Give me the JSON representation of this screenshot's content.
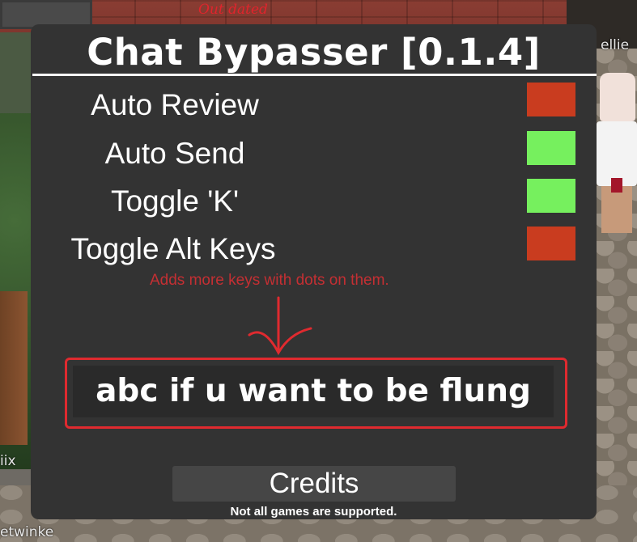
{
  "overlay": {
    "outdated_note": "Out dated"
  },
  "background": {
    "name_tags": [
      "ellie",
      "iix",
      "etwinke"
    ]
  },
  "panel": {
    "title": "Chat Bypasser [0.1.4]",
    "toggles": [
      {
        "label": "Auto Review",
        "state": "off",
        "color": "#c93c1f"
      },
      {
        "label": "Auto Send",
        "state": "on",
        "color": "#76f05e"
      },
      {
        "label": "Toggle 'K'",
        "state": "on",
        "color": "#76f05e"
      },
      {
        "label": "Toggle Alt Keys",
        "state": "off",
        "color": "#c93c1f"
      }
    ],
    "hint": "Adds more keys with dots on them.",
    "message_value": "abc if u want to be flung",
    "credits_label": "Credits",
    "footer": "Not all games are supported."
  }
}
